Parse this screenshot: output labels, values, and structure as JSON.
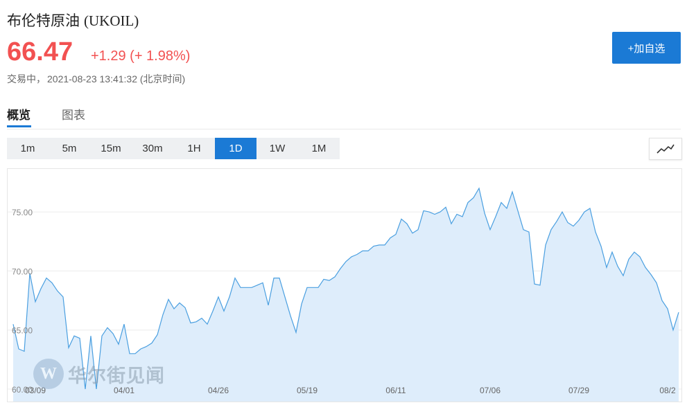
{
  "header": {
    "name": "布伦特原油",
    "symbol": "(UKOIL)",
    "price": "66.47",
    "change": "+1.29 (+ 1.98%)",
    "status": "交易中，",
    "datetime": "2021-08-23 13:41:32 (北京时间)",
    "watch_label": "+加自选"
  },
  "tabs": [
    {
      "label": "概览",
      "active": true
    },
    {
      "label": "图表",
      "active": false
    }
  ],
  "periods": [
    {
      "label": "1m"
    },
    {
      "label": "5m"
    },
    {
      "label": "15m"
    },
    {
      "label": "30m"
    },
    {
      "label": "1H"
    },
    {
      "label": "1D",
      "active": true
    },
    {
      "label": "1W"
    },
    {
      "label": "1M"
    }
  ],
  "chart_type_icon": "line-chart-icon",
  "watermark": {
    "logo": "W",
    "text": "华尔街见闻"
  },
  "colors": {
    "accent": "#1b7ad5",
    "up": "#f25151",
    "line": "#4a9fe0",
    "area": "#deedfb"
  },
  "chart_data": {
    "type": "area",
    "title": "",
    "xlabel": "",
    "ylabel": "",
    "ylim": [
      60.0,
      77.0
    ],
    "grid": "horizontal",
    "y_ticks": [
      "60.00",
      "65.00",
      "70.00",
      "75.00"
    ],
    "y_tick_values": [
      60,
      65,
      70,
      75
    ],
    "x_ticks": [
      "03/09",
      "04/01",
      "04/26",
      "05/19",
      "06/11",
      "07/06",
      "07/29",
      "08/2"
    ],
    "x_tick_positions": [
      4,
      20,
      37,
      53,
      69,
      86,
      102,
      118
    ],
    "series": [
      {
        "values": [
          65.5,
          63.4,
          63.2,
          69.8,
          67.4,
          68.5,
          69.4,
          69.0,
          68.3,
          67.8,
          63.5,
          64.5,
          64.3,
          60.0,
          64.5,
          60.0,
          64.5,
          65.2,
          64.7,
          63.8,
          65.5,
          63.0,
          63.0,
          63.4,
          63.6,
          63.9,
          64.6,
          66.3,
          67.6,
          66.8,
          67.3,
          66.9,
          65.6,
          65.7,
          66.0,
          65.5,
          66.6,
          67.8,
          66.6,
          67.8,
          69.4,
          68.6,
          68.6,
          68.6,
          68.8,
          69.0,
          67.1,
          69.4,
          69.4,
          67.8,
          66.2,
          64.8,
          67.2,
          68.6,
          68.6,
          68.6,
          69.3,
          69.2,
          69.5,
          70.2,
          70.8,
          71.2,
          71.4,
          71.7,
          71.7,
          72.1,
          72.2,
          72.2,
          72.8,
          73.1,
          74.4,
          74.0,
          73.2,
          73.5,
          75.1,
          75.0,
          74.8,
          75.0,
          75.4,
          74.0,
          74.8,
          74.6,
          75.8,
          76.2,
          77.0,
          74.9,
          73.5,
          74.6,
          75.8,
          75.3,
          76.7,
          75.1,
          73.5,
          73.3,
          68.9,
          68.8,
          72.2,
          73.5,
          74.2,
          75.0,
          74.1,
          73.8,
          74.3,
          75.0,
          75.3,
          73.3,
          72.1,
          70.3,
          71.6,
          70.4,
          69.6,
          71.0,
          71.6,
          71.2,
          70.3,
          69.7,
          69.0,
          67.5,
          66.8,
          65.0,
          66.5
        ]
      }
    ]
  }
}
